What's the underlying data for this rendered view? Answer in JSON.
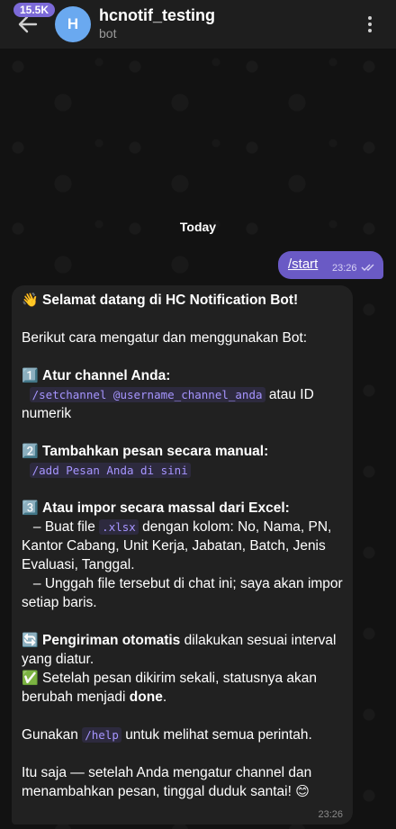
{
  "header": {
    "back_badge": "15.5K",
    "avatar_letter": "H",
    "title": "hcnotif_testing",
    "subtitle": "bot"
  },
  "chat": {
    "date_label": "Today",
    "outgoing": {
      "text": "/start",
      "time": "23:26"
    },
    "incoming": {
      "time": "23:26",
      "line_title_emoji": "👋",
      "line_title": "Selamat datang di HC Notification Bot!",
      "intro": "Berikut cara mengatur dan menggunakan Bot:",
      "s1_emoji": "1️⃣",
      "s1_title": "Atur channel Anda:",
      "s1_code": "/setchannel @username_channel_anda",
      "s1_tail": "atau ID numerik",
      "s2_emoji": "2️⃣",
      "s2_title": "Tambahkan pesan secara manual:",
      "s2_code": "/add Pesan Anda di sini",
      "s3_emoji": "3️⃣",
      "s3_title": "Atau impor secara massal dari Excel:",
      "s3_b1_pre": "– Buat file",
      "s3_b1_code": ".xlsx",
      "s3_b1_post": "dengan kolom: No, Nama, PN, Kantor Cabang, Unit Kerja, Jabatan, Batch, Jenis Evaluasi, Tanggal.",
      "s3_b2": "– Unggah file tersebut di chat ini; saya akan impor setiap baris.",
      "auto_emoji": "🔄",
      "auto_bold": "Pengiriman otomatis",
      "auto_rest": "dilakukan sesuai interval yang diatur.",
      "done_emoji": "✅",
      "done_pre": "Setelah pesan dikirim sekali, statusnya akan berubah menjadi",
      "done_bold": "done",
      "done_post": ".",
      "help_pre": "Gunakan",
      "help_code": "/help",
      "help_post": "untuk melihat semua perintah.",
      "outro": "Itu saja — setelah Anda mengatur channel dan menambahkan pesan, tinggal duduk santai!",
      "outro_emoji": "😊"
    }
  },
  "colors": {
    "accent": "#6a5ac5",
    "badge": "#7c6ad8",
    "avatar": "#6aa9f0",
    "code_text": "#a695ff"
  }
}
